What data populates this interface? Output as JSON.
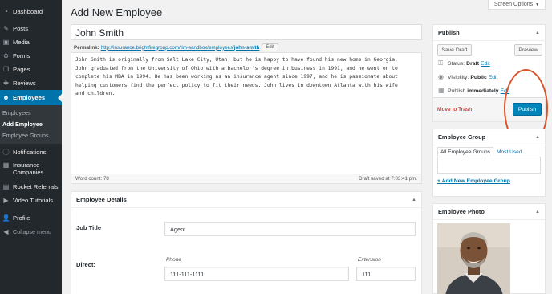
{
  "sidebar": {
    "items": [
      {
        "label": "Dashboard",
        "icon": "dashboard-icon"
      },
      {
        "label": "Posts",
        "icon": "pin-icon"
      },
      {
        "label": "Media",
        "icon": "media-icon"
      },
      {
        "label": "Forms",
        "icon": "forms-icon"
      },
      {
        "label": "Pages",
        "icon": "pages-icon"
      },
      {
        "label": "Reviews",
        "icon": "reviews-icon"
      },
      {
        "label": "Employees",
        "icon": "employees-icon"
      }
    ],
    "submenu": [
      "Employees",
      "Add Employee",
      "Employee Groups"
    ],
    "items2": [
      {
        "label": "Notifications",
        "icon": "info-icon"
      },
      {
        "label": "Insurance Companies",
        "icon": "grid-icon"
      },
      {
        "label": "Rocket Referrals",
        "icon": "rocket-icon"
      },
      {
        "label": "Video Tutorials",
        "icon": "video-icon"
      },
      {
        "label": "Profile",
        "icon": "user-icon"
      },
      {
        "label": "Collapse menu",
        "icon": "collapse-icon"
      }
    ]
  },
  "screen_options": "Screen Options",
  "page_title": "Add New Employee",
  "title_value": "John Smith",
  "permalink": {
    "label": "Permalink:",
    "url": "http://insurance.brightfiregroup.com/tim-sandbox/employees/",
    "slug": "john-smith",
    "edit": "Edit"
  },
  "editor": {
    "lines": [
      "John Smith is originally from Salt Lake City, Utah, but he is happy to have found his new home in Georgia.",
      "John graduated from the University of Ohio with a bachelor's degree in business in 1991, and he went on to",
      "complete his MBA in 1994. He has been working as an insurance agent since 1997, and he is passionate about",
      "helping customers find the perfect policy to fit their needs. John lives in downtown Atlanta with his wife",
      "and children."
    ],
    "word_count": "Word count: 78",
    "draft_saved": "Draft saved at 7:03:41 pm."
  },
  "details": {
    "title": "Employee Details",
    "job_title_label": "Job Title",
    "job_title_value": "Agent",
    "direct_label": "Direct:",
    "phone_hint": "Phone",
    "phone_value": "111-111-1111",
    "extension_hint": "Extension",
    "extension_value": "111"
  },
  "publish": {
    "title": "Publish",
    "save_draft": "Save Draft",
    "preview": "Preview",
    "status_label": "Status:",
    "status_value": "Draft",
    "visibility_label": "Visibility:",
    "visibility_value": "Public",
    "schedule_label": "Publish",
    "schedule_value": "immediately",
    "edit": "Edit",
    "trash": "Move to Trash",
    "publish_button": "Publish"
  },
  "group": {
    "title": "Employee Group",
    "tab_all": "All Employee Groups",
    "tab_most": "Most Used",
    "add_new": "+ Add New Employee Group"
  },
  "photo": {
    "title": "Employee Photo"
  },
  "colors": {
    "sidebar": "#23282d",
    "accent": "#0073aa",
    "publish_button": "#0085ba",
    "annotation": "#d9532c"
  }
}
